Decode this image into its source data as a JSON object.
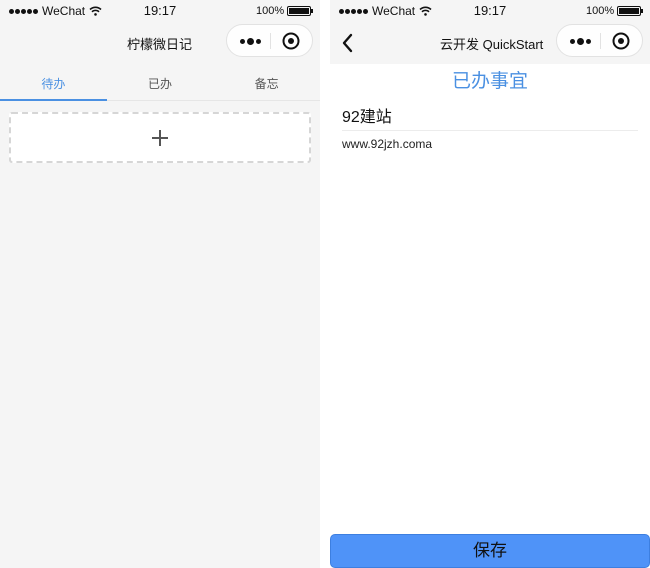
{
  "left_phone": {
    "status_bar": {
      "carrier": "WeChat",
      "time": "19:17",
      "battery": "100%"
    },
    "nav": {
      "title": "柠檬微日记"
    },
    "tabs": [
      {
        "label": "待办",
        "active": true
      },
      {
        "label": "已办",
        "active": false
      },
      {
        "label": "备忘",
        "active": false
      }
    ],
    "add_button": {
      "icon": "plus-icon"
    }
  },
  "right_phone": {
    "status_bar": {
      "carrier": "WeChat",
      "time": "19:17",
      "battery": "100%"
    },
    "nav": {
      "title": "云开发 QuickStart",
      "back_icon": "chevron-left-icon"
    },
    "heading": "已办事宜",
    "item": {
      "title": "92建站",
      "content": "www.92jzh.coma"
    },
    "save_label": "保存"
  },
  "colors": {
    "accent": "#4a90e2",
    "save_button": "#4f93f8",
    "page_background": "#f5f5f5"
  }
}
